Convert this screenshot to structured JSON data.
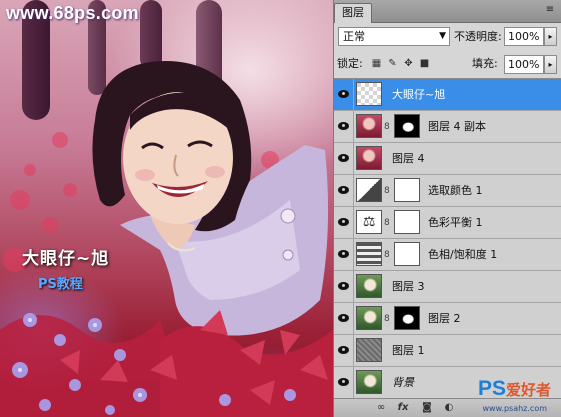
{
  "watermark": {
    "site_url": "www.68ps.com",
    "title_text": "大眼仔~旭",
    "tutorial_badge": "PS教程",
    "corner_logo_ps": "PS",
    "corner_logo_cn": "爱好者",
    "corner_url": "www.psahz.com"
  },
  "panel": {
    "tab_label": "图层",
    "blend_mode": "正常",
    "opacity_label": "不透明度:",
    "opacity_value": "100%",
    "lock_label": "锁定:",
    "fill_label": "填充:",
    "fill_value": "100%"
  },
  "layers": [
    {
      "name": "大眼仔~旭",
      "selected": true,
      "visible": true,
      "thumb": "transparent",
      "mask": false
    },
    {
      "name": "图层 4 副本",
      "selected": false,
      "visible": true,
      "thumb": "photo-red",
      "mask": true,
      "mask_type": "black-white-blob"
    },
    {
      "name": "图层 4",
      "selected": false,
      "visible": true,
      "thumb": "photo-red",
      "mask": false
    },
    {
      "name": "选取颜色 1",
      "selected": false,
      "visible": true,
      "thumb": "adjust-selective-color",
      "mask": true,
      "mask_type": "white"
    },
    {
      "name": "色彩平衡 1",
      "selected": false,
      "visible": true,
      "thumb": "adjust-color-balance",
      "mask": true,
      "mask_type": "white"
    },
    {
      "name": "色相/饱和度 1",
      "selected": false,
      "visible": true,
      "thumb": "adjust-hue-saturation",
      "mask": true,
      "mask_type": "white"
    },
    {
      "name": "图层 3",
      "selected": false,
      "visible": true,
      "thumb": "photo-green",
      "mask": false
    },
    {
      "name": "图层 2",
      "selected": false,
      "visible": true,
      "thumb": "photo-green",
      "mask": true,
      "mask_type": "black-white-blob"
    },
    {
      "name": "图层 1",
      "selected": false,
      "visible": true,
      "thumb": "noise-gray",
      "mask": false
    },
    {
      "name": "背景",
      "selected": false,
      "visible": true,
      "thumb": "photo-green",
      "mask": false,
      "italic": true
    }
  ],
  "colors": {
    "selected_row": "#3a8ee8",
    "panel_bg": "#d6d6d6"
  }
}
